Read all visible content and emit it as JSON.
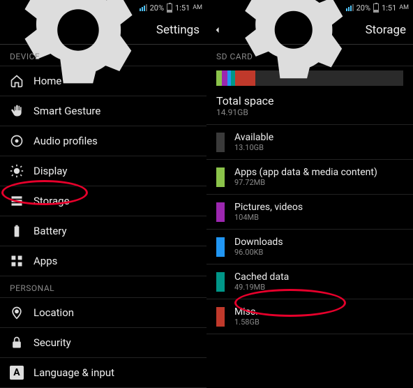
{
  "status": {
    "battery_pct": "20%",
    "time": "1:51",
    "ampm": "AM"
  },
  "left": {
    "title": "Settings",
    "section_device": "DEVICE",
    "section_personal": "PERSONAL",
    "items": {
      "home": "Home",
      "smart_gesture": "Smart Gesture",
      "audio_profiles": "Audio profiles",
      "display": "Display",
      "storage": "Storage",
      "battery": "Battery",
      "apps": "Apps",
      "location": "Location",
      "security": "Security",
      "language_input": "Language & input"
    }
  },
  "right": {
    "title": "Storage",
    "sd_card_label": "SD CARD",
    "total": {
      "label": "Total space",
      "value": "14.91GB"
    },
    "categories": [
      {
        "key": "available",
        "label": "Available",
        "value": "13.10GB",
        "color": "#3a3a3a"
      },
      {
        "key": "apps",
        "label": "Apps (app data & media content)",
        "value": "97.72MB",
        "color": "#8bc34a"
      },
      {
        "key": "pictures",
        "label": "Pictures, videos",
        "value": "104MB",
        "color": "#9c27b0"
      },
      {
        "key": "downloads",
        "label": "Downloads",
        "value": "96.00KB",
        "color": "#2196f3"
      },
      {
        "key": "cached",
        "label": "Cached data",
        "value": "49.19MB",
        "color": "#009688"
      },
      {
        "key": "misc",
        "label": "Misc.",
        "value": "1.58GB",
        "color": "#c0392b"
      }
    ],
    "bar_segments": [
      {
        "color": "#8bc34a",
        "pct": 3
      },
      {
        "color": "#9c27b0",
        "pct": 3
      },
      {
        "color": "#2196f3",
        "pct": 2
      },
      {
        "color": "#009688",
        "pct": 2
      },
      {
        "color": "#c0392b",
        "pct": 11
      }
    ]
  }
}
